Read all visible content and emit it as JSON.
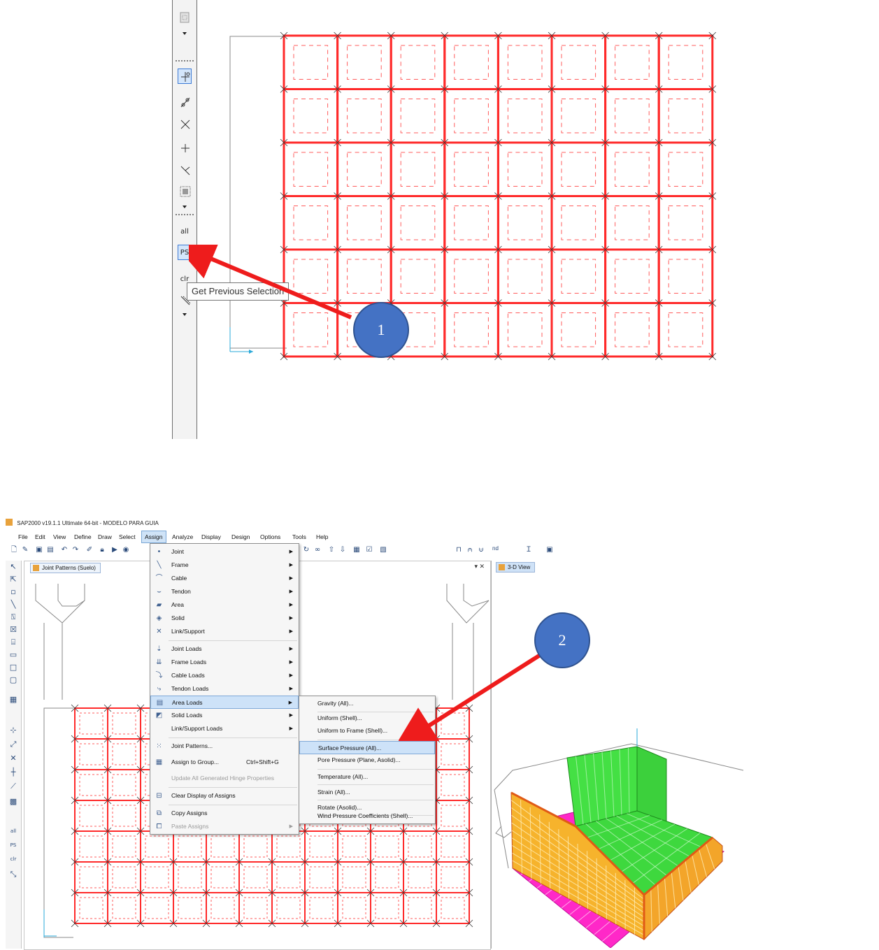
{
  "top_panel": {
    "tooltip": "Get Previous Selection",
    "tool_labels": {
      "all": "all",
      "ps": "PS",
      "clr": "clr"
    },
    "callout_number": "1"
  },
  "app": {
    "title": "SAP2000 v19.1.1 Ultimate 64-bit - MODELO PARA GUIA",
    "menu": [
      "File",
      "Edit",
      "View",
      "Define",
      "Draw",
      "Select",
      "Assign",
      "Analyze",
      "Display",
      "Design",
      "Options",
      "Tools",
      "Help"
    ],
    "open_menu": "Assign",
    "toolbar_text": {
      "nd": "nd"
    },
    "tabs": {
      "left": "Joint Patterns (Suelo)",
      "right": "3-D View",
      "close_glyph": "▾ ✕"
    },
    "assign_menu": [
      {
        "label": "Joint",
        "submenu": true,
        "icon": "joint-icon"
      },
      {
        "label": "Frame",
        "submenu": true,
        "icon": "frame-icon"
      },
      {
        "label": "Cable",
        "submenu": true,
        "icon": "cable-icon"
      },
      {
        "label": "Tendon",
        "submenu": true,
        "icon": "tendon-icon"
      },
      {
        "label": "Area",
        "submenu": true,
        "icon": "area-icon"
      },
      {
        "label": "Solid",
        "submenu": true,
        "icon": "solid-icon"
      },
      {
        "label": "Link/Support",
        "submenu": true,
        "icon": "link-icon"
      },
      {
        "label": "Joint Loads",
        "submenu": true,
        "icon": "joint-loads-icon"
      },
      {
        "label": "Frame Loads",
        "submenu": true,
        "icon": "frame-loads-icon"
      },
      {
        "label": "Cable Loads",
        "submenu": true,
        "icon": "cable-loads-icon"
      },
      {
        "label": "Tendon Loads",
        "submenu": true,
        "icon": "tendon-loads-icon"
      },
      {
        "label": "Area Loads",
        "submenu": true,
        "icon": "area-loads-icon",
        "highlighted": true
      },
      {
        "label": "Solid Loads",
        "submenu": true,
        "icon": "solid-loads-icon"
      },
      {
        "label": "Link/Support Loads",
        "submenu": true,
        "icon": ""
      },
      {
        "label": "Joint Patterns...",
        "submenu": false,
        "icon": "joint-patterns-icon"
      },
      {
        "label": "Assign to Group...",
        "shortcut": "Ctrl+Shift+G",
        "submenu": false,
        "icon": "group-icon"
      },
      {
        "label": "Update All Generated Hinge Properties",
        "submenu": false,
        "disabled": true,
        "icon": ""
      },
      {
        "label": "Clear Display of Assigns",
        "submenu": false,
        "icon": "clear-display-icon"
      },
      {
        "label": "Copy Assigns",
        "submenu": false,
        "icon": "copy-icon"
      },
      {
        "label": "Paste Assigns",
        "submenu": true,
        "disabled": true,
        "icon": "paste-icon"
      }
    ],
    "area_loads_submenu": [
      {
        "label": "Gravity (All)..."
      },
      {
        "label": "Uniform (Shell)..."
      },
      {
        "label": "Uniform to Frame (Shell)..."
      },
      {
        "label": "Surface Pressure (All)...",
        "highlighted": true
      },
      {
        "label": "Pore Pressure (Plane, Asolid)..."
      },
      {
        "label": "Temperature (All)..."
      },
      {
        "label": "Strain (All)..."
      },
      {
        "label": "Rotate (Asolid)..."
      },
      {
        "label": "Wind Pressure Coefficients (Shell)..."
      }
    ],
    "callout_number": "2"
  },
  "colors": {
    "grid_red": "#ff2a2a",
    "dash_red": "#ff5c5c",
    "callout_blue": "#4472c4",
    "arrow_red": "#ee1c1c",
    "walls_yellow": "#f6b32c",
    "floor_green": "#44e044",
    "base_magenta": "#ff28c8"
  }
}
